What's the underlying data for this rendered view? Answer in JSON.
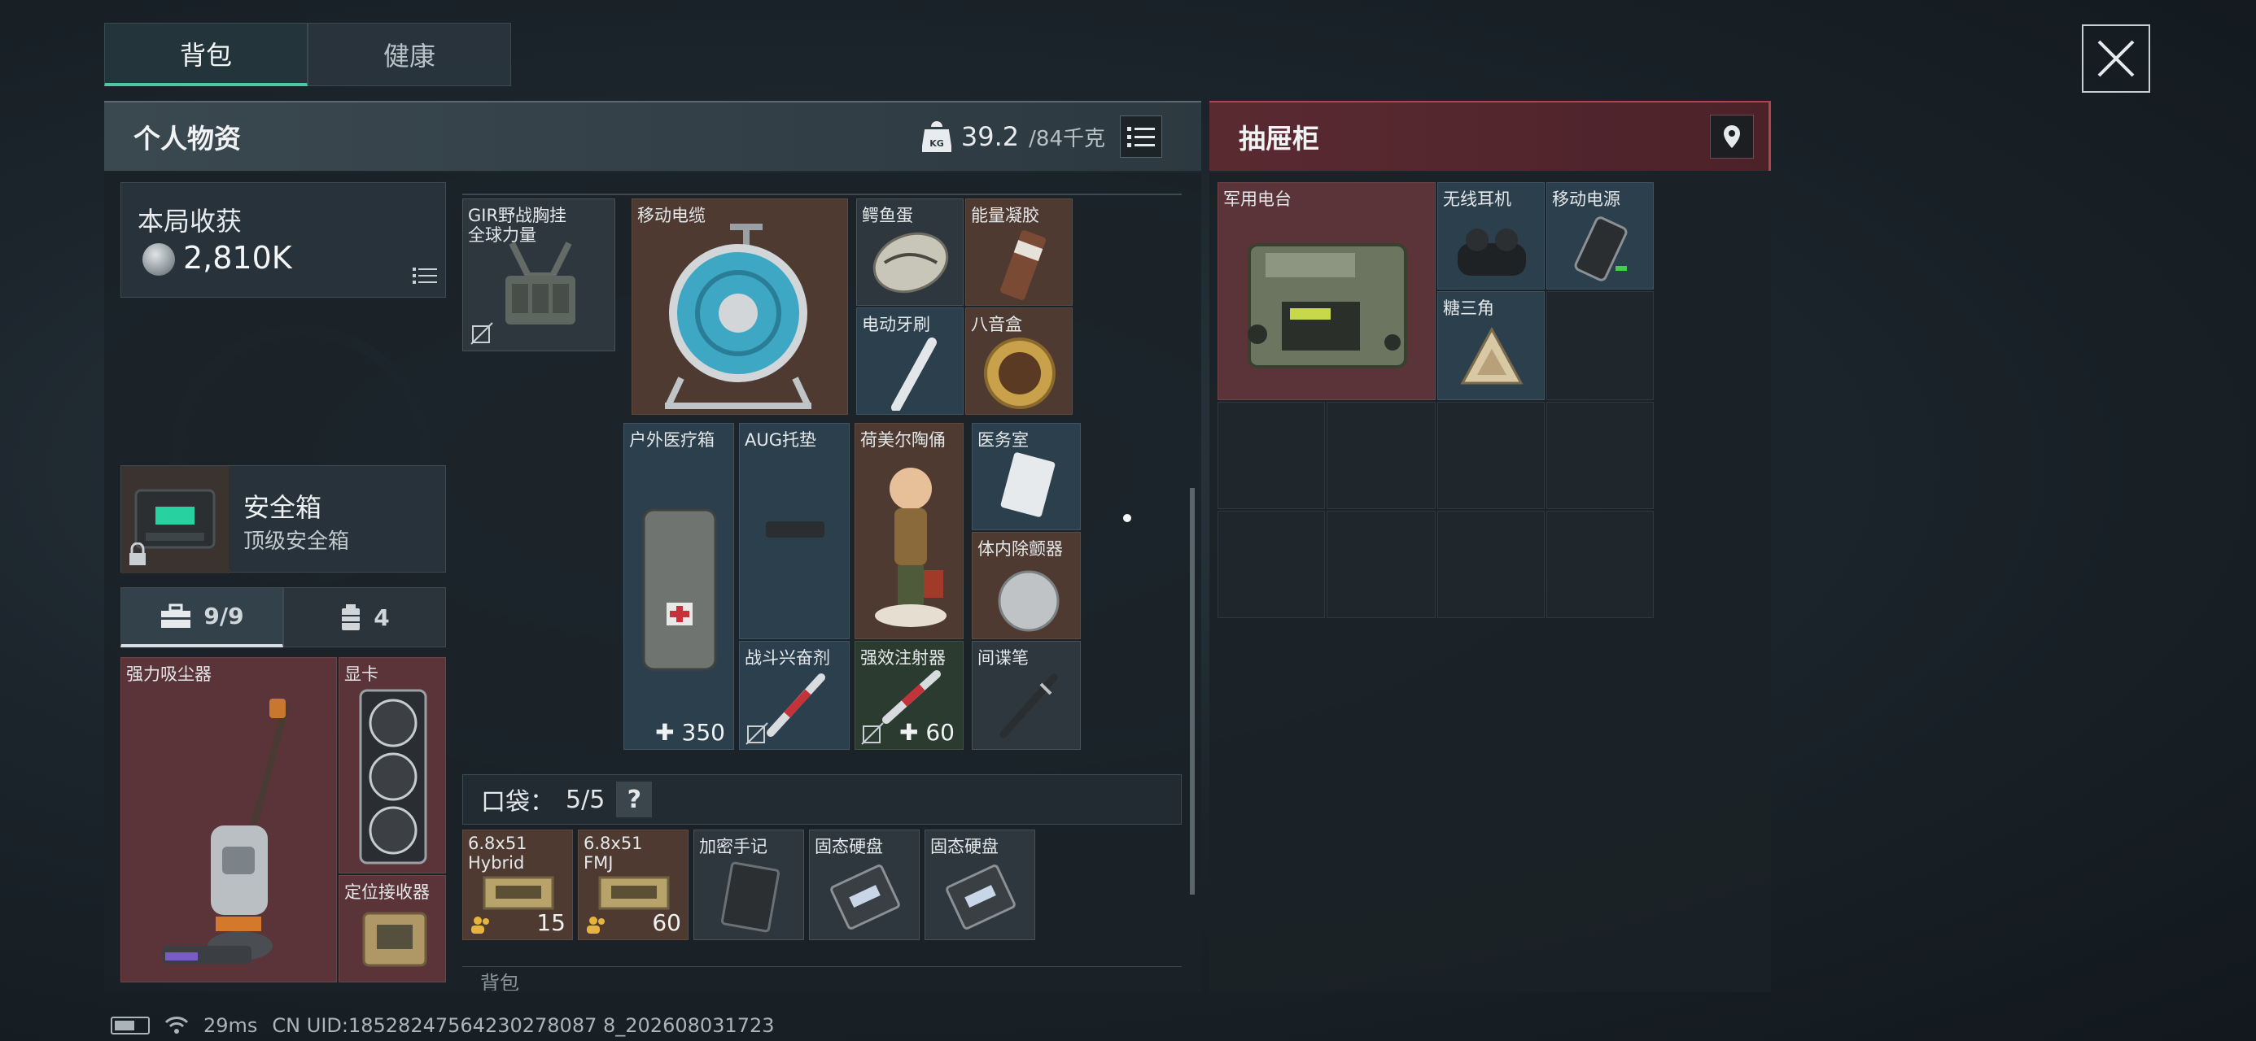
{
  "tabs": [
    {
      "label": "背包"
    },
    {
      "label": "健康"
    }
  ],
  "personal": {
    "title": "个人物资",
    "weight_value": "39.2",
    "weight_cap": "/84千克"
  },
  "drawer": {
    "title": "抽屉柜",
    "items": [
      {
        "name": "军用电台"
      },
      {
        "name": "无线耳机"
      },
      {
        "name": "移动电源"
      },
      {
        "name": "糖三角"
      }
    ]
  },
  "harvest": {
    "label": "本局收获",
    "value": "2,810K"
  },
  "safe": {
    "name": "安全箱",
    "sub": "顶级安全箱"
  },
  "small_tabs": [
    {
      "label": "9/9"
    },
    {
      "label": "4"
    }
  ],
  "equip": [
    {
      "name": "强力吸尘器"
    },
    {
      "name": "显卡"
    },
    {
      "name": "定位接收器"
    }
  ],
  "rig": {
    "name": "GIR野战胸挂",
    "sub": "全球力量"
  },
  "items": [
    {
      "name": "移动电缆"
    },
    {
      "name": "鳄鱼蛋"
    },
    {
      "name": "能量凝胶"
    },
    {
      "name": "电动牙刷"
    },
    {
      "name": "八音盒"
    },
    {
      "name": "户外医疗箱",
      "buff": "350"
    },
    {
      "name": "AUG托垫"
    },
    {
      "name": "荷美尔陶俑"
    },
    {
      "name": "医务室"
    },
    {
      "name": "体内除颤器"
    },
    {
      "name": "战斗兴奋剂"
    },
    {
      "name": "强效注射器",
      "buff": "60"
    },
    {
      "name": "间谍笔"
    }
  ],
  "pocket": {
    "label": "口袋：",
    "count": "5/5",
    "help": "?"
  },
  "pocket_items": [
    {
      "name": "6.8x51",
      "sub": "Hybrid",
      "qty": "15"
    },
    {
      "name": "6.8x51",
      "sub": "FMJ",
      "qty": "60"
    },
    {
      "name": "加密手记"
    },
    {
      "name": "固态硬盘"
    },
    {
      "name": "固态硬盘"
    }
  ],
  "backpack_stub": "背包",
  "status": {
    "ping": "29ms",
    "uid": "CN UID:18528247564230278087 8_202608031723"
  },
  "colors": {
    "accent": "#4dc7a2",
    "drawer_red": "#b0434e"
  }
}
